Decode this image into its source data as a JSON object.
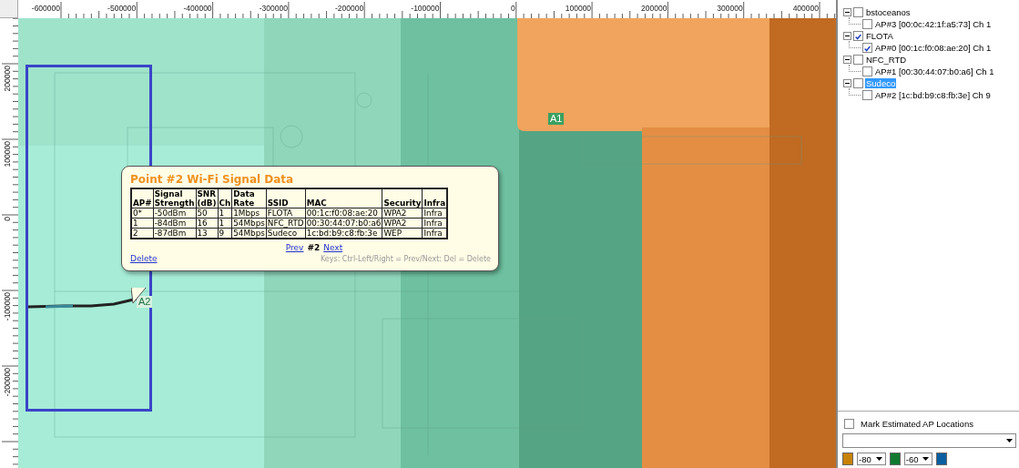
{
  "map": {
    "x_ruler": [
      "-600000",
      "-500000",
      "-400000",
      "-300000",
      "-200000",
      "-100000",
      "0",
      "100000",
      "200000",
      "300000",
      "400000"
    ],
    "y_ruler": [
      "200000",
      "100000",
      "0",
      "-100000",
      "-200000"
    ],
    "markers": [
      {
        "kind": "ap",
        "label": "A1"
      },
      {
        "kind": "point",
        "label": "A2"
      }
    ],
    "popup": {
      "title": "Point #2 Wi-Fi Signal Data",
      "columns": [
        "AP#",
        "Signal Strength",
        "SNR (dB)",
        "Ch",
        "Data Rate",
        "SSID",
        "MAC",
        "Security",
        "Infra"
      ],
      "rows": [
        [
          "0*",
          "-50dBm",
          "50",
          "1",
          "1Mbps",
          "FLOTA",
          "00:1c:f0:08:ae:20",
          "WPA2",
          "Infra"
        ],
        [
          "1",
          "-84dBm",
          "16",
          "1",
          "54Mbps",
          "NFC_RTD",
          "00:30:44:07:b0:a6",
          "WPA2",
          "Infra"
        ],
        [
          "2",
          "-87dBm",
          "13",
          "9",
          "54Mbps",
          "Sudeco",
          "1c:bd:b9:c8:fb:3e",
          "WEP",
          "Infra"
        ]
      ],
      "prev": "Prev",
      "current": "#2",
      "next": "Next",
      "delete": "Delete",
      "keys_hint": "Keys: Ctrl-Left/Right = Prev/Next: Del = Delete"
    }
  },
  "tree": [
    {
      "label": "bstoceanos",
      "checked": false,
      "selected": false,
      "expanded": true,
      "children": [
        {
          "label": "AP#3 [00:0c:42:1f:a5:73] Ch 1",
          "checked": false
        }
      ]
    },
    {
      "label": "FLOTA",
      "checked": true,
      "selected": false,
      "expanded": true,
      "children": [
        {
          "label": "AP#0 [00:1c:f0:08:ae:20] Ch 1",
          "checked": true
        }
      ]
    },
    {
      "label": "NFC_RTD",
      "checked": false,
      "selected": false,
      "expanded": true,
      "children": [
        {
          "label": "AP#1 [00:30:44:07:b0:a6] Ch 1",
          "checked": false
        }
      ]
    },
    {
      "label": "Sudeco",
      "checked": false,
      "selected": true,
      "expanded": true,
      "children": [
        {
          "label": "AP#2 [1c:bd:b9:c8:fb:3e] Ch 9",
          "checked": false
        }
      ]
    }
  ],
  "mark_estimated": {
    "label": "Mark Estimated AP Locations",
    "checked": false
  },
  "legend": [
    {
      "kind": "swatch",
      "color": "#c8820a"
    },
    {
      "kind": "select",
      "value": "-80"
    },
    {
      "kind": "swatch",
      "color": "#107a30"
    },
    {
      "kind": "select",
      "value": "-60"
    },
    {
      "kind": "swatch",
      "color": "#0a60a0"
    }
  ]
}
